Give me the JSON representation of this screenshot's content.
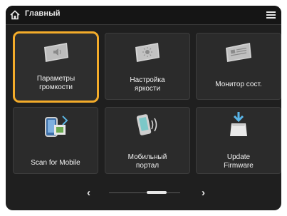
{
  "header": {
    "title": "Главный",
    "home_icon": "home-icon",
    "menu_icon": "menu-icon"
  },
  "tiles": [
    {
      "label": "Параметры\nгромкости",
      "icon": "volume-settings-icon",
      "selected": true
    },
    {
      "label": "Настройка\nяркости",
      "icon": "brightness-settings-icon",
      "selected": false
    },
    {
      "label": "Монитор сост.",
      "icon": "status-monitor-icon",
      "selected": false
    },
    {
      "label": "Scan for Mobile",
      "icon": "scan-for-mobile-icon",
      "selected": false
    },
    {
      "label": "Мобильный\nпортал",
      "icon": "mobile-portal-icon",
      "selected": false
    },
    {
      "label": "Update\nFirmware",
      "icon": "update-firmware-icon",
      "selected": false
    }
  ],
  "pager": {
    "prev": "‹",
    "next": "›"
  },
  "colors": {
    "background": "#1f1f1f",
    "tile": "#2b2b2b",
    "selected_border": "#f4ac2a",
    "text": "#f2f2f2"
  }
}
